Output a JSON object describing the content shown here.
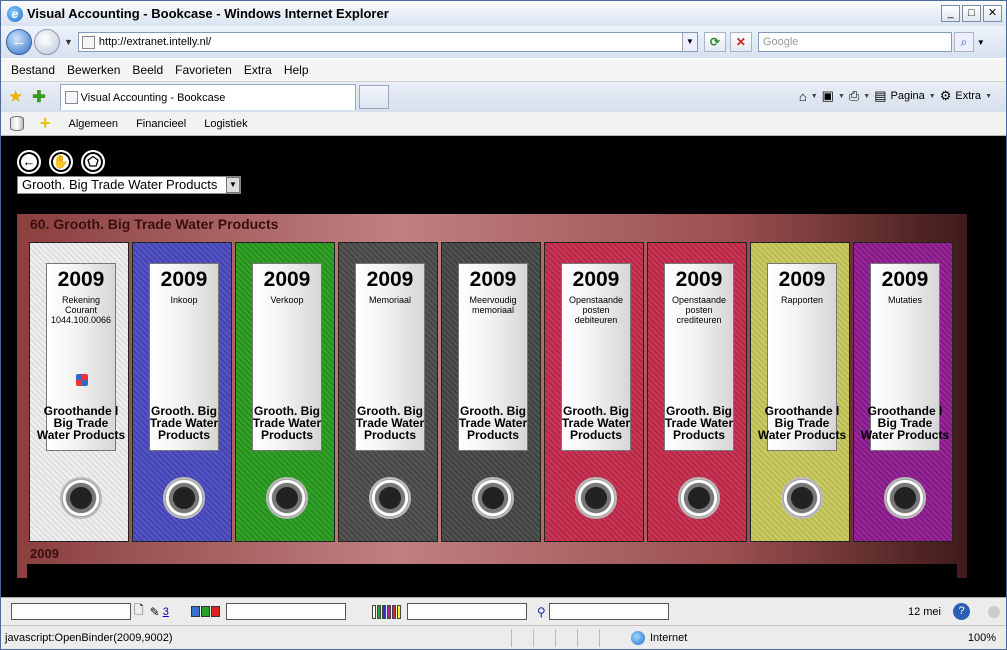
{
  "window": {
    "title": "Visual Accounting - Bookcase - Windows Internet Explorer"
  },
  "address": {
    "url": "http://extranet.intelly.nl/",
    "search_placeholder": "Google"
  },
  "menu": [
    "Bestand",
    "Bewerken",
    "Beeld",
    "Favorieten",
    "Extra",
    "Help"
  ],
  "tab": {
    "label": "Visual Accounting - Bookcase"
  },
  "command_bar": {
    "page_label": "Pagina",
    "tools_label": "Extra"
  },
  "app_toolbar": {
    "items": [
      "Algemeen",
      "Financieel",
      "Logistiek"
    ]
  },
  "selector": {
    "value": "Grooth. Big Trade Water Products"
  },
  "shelf": {
    "title": "60. Grooth. Big Trade Water Products",
    "bottom_year": "2009",
    "binders": [
      {
        "year": "2009",
        "desc": "Rekening Courant 1044.100.0066",
        "owner": "Groothande l Big Trade Water Products",
        "color": "#efefef",
        "logo": true
      },
      {
        "year": "2009",
        "desc": "Inkoop",
        "owner": "Grooth. Big Trade Water Products",
        "color": "#4848c0",
        "logo": false
      },
      {
        "year": "2009",
        "desc": "Verkoop",
        "owner": "Grooth. Big Trade Water Products",
        "color": "#289a1e",
        "logo": false
      },
      {
        "year": "2009",
        "desc": "Memoriaal",
        "owner": "Grooth. Big Trade Water Products",
        "color": "#4a4a4a",
        "logo": false
      },
      {
        "year": "2009",
        "desc": "Meervoudig memoriaal",
        "owner": "Grooth. Big Trade Water Products",
        "color": "#454545",
        "logo": false
      },
      {
        "year": "2009",
        "desc": "Openstaande posten debiteuren",
        "owner": "Grooth. Big Trade Water Products",
        "color": "#c42a4a",
        "logo": false
      },
      {
        "year": "2009",
        "desc": "Openstaande posten crediteuren",
        "owner": "Grooth. Big Trade Water Products",
        "color": "#c42a4a",
        "logo": false
      },
      {
        "year": "2009",
        "desc": "Rapporten",
        "owner": "Groothande l Big Trade Water Products",
        "color": "#c8c858",
        "logo": false
      },
      {
        "year": "2009",
        "desc": "Mutaties",
        "owner": "Groothande l Big Trade Water Products",
        "color": "#8e1a8e",
        "logo": false
      }
    ]
  },
  "statusbar": {
    "count": "3",
    "date": "12 mei",
    "status_text": "javascript:OpenBinder(2009,9002)",
    "zone": "Internet",
    "zoom": "100%"
  }
}
